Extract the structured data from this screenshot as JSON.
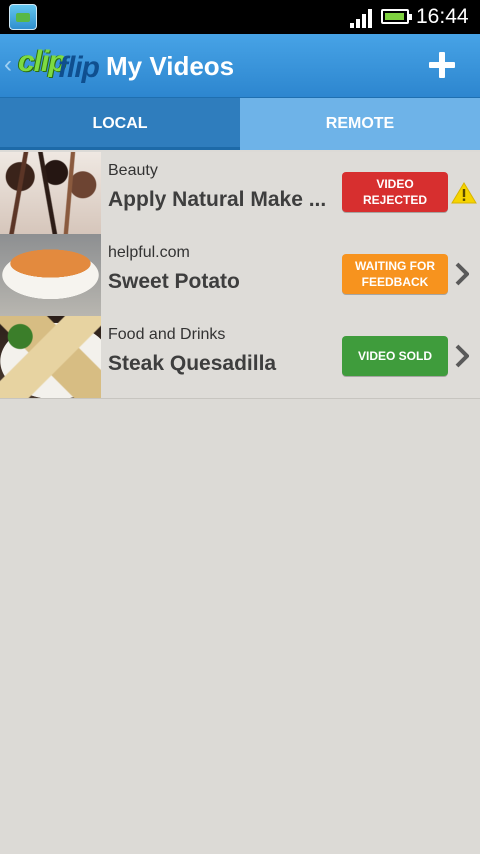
{
  "status_bar": {
    "time": "16:44",
    "icons": [
      "app-notification-icon",
      "signal-icon",
      "battery-icon"
    ],
    "battery_level": 0.85
  },
  "action_bar": {
    "logo_text_clip": "clip",
    "logo_text_flip": "flip",
    "title": "My Videos",
    "back_icon": "chevron-left-icon",
    "add_icon": "plus-icon"
  },
  "tabs": [
    {
      "label": "LOCAL",
      "selected": true
    },
    {
      "label": "REMOTE",
      "selected": false
    }
  ],
  "videos": [
    {
      "category": "Beauty",
      "title": "Apply Natural Make ...",
      "status": "VIDEO REJECTED",
      "status_color": "#d72f2f",
      "trailing_icon": "warning-icon"
    },
    {
      "category": "helpful.com",
      "title": "Sweet Potato",
      "status": "WAITING FOR FEEDBACK",
      "status_color": "#f7931e",
      "trailing_icon": "chevron-right-icon"
    },
    {
      "category": "Food and Drinks",
      "title": "Steak Quesadilla",
      "status": "VIDEO SOLD",
      "status_color": "#3f9c3c",
      "trailing_icon": "chevron-right-icon"
    }
  ],
  "colors": {
    "action_bar": "#2d86cf",
    "tab_selected": "#2f7dbd",
    "tab_unselected": "#6eb3e8",
    "background": "#dcdad6"
  }
}
